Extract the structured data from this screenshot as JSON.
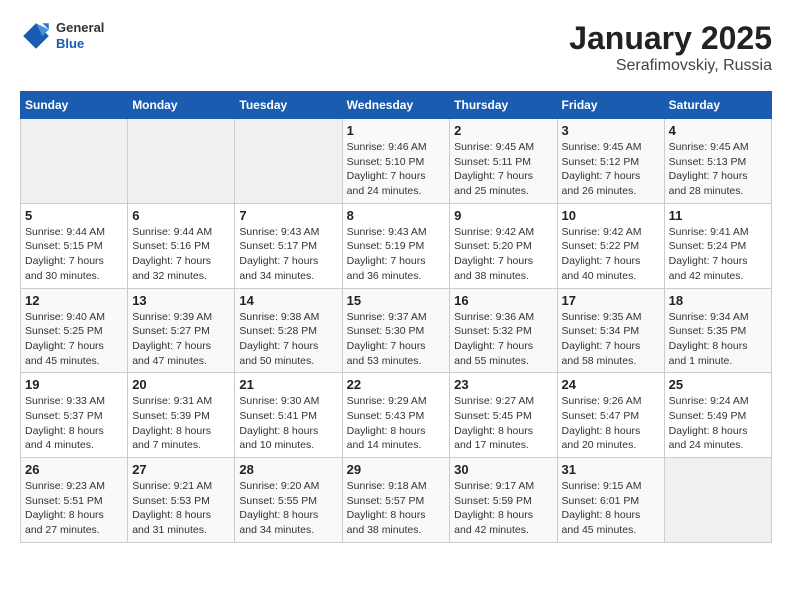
{
  "header": {
    "logo": {
      "general": "General",
      "blue": "Blue"
    },
    "title": "January 2025",
    "subtitle": "Serafimovskiy, Russia"
  },
  "weekdays": [
    "Sunday",
    "Monday",
    "Tuesday",
    "Wednesday",
    "Thursday",
    "Friday",
    "Saturday"
  ],
  "weeks": [
    [
      {
        "day": "",
        "info": ""
      },
      {
        "day": "",
        "info": ""
      },
      {
        "day": "",
        "info": ""
      },
      {
        "day": "1",
        "info": "Sunrise: 9:46 AM\nSunset: 5:10 PM\nDaylight: 7 hours\nand 24 minutes."
      },
      {
        "day": "2",
        "info": "Sunrise: 9:45 AM\nSunset: 5:11 PM\nDaylight: 7 hours\nand 25 minutes."
      },
      {
        "day": "3",
        "info": "Sunrise: 9:45 AM\nSunset: 5:12 PM\nDaylight: 7 hours\nand 26 minutes."
      },
      {
        "day": "4",
        "info": "Sunrise: 9:45 AM\nSunset: 5:13 PM\nDaylight: 7 hours\nand 28 minutes."
      }
    ],
    [
      {
        "day": "5",
        "info": "Sunrise: 9:44 AM\nSunset: 5:15 PM\nDaylight: 7 hours\nand 30 minutes."
      },
      {
        "day": "6",
        "info": "Sunrise: 9:44 AM\nSunset: 5:16 PM\nDaylight: 7 hours\nand 32 minutes."
      },
      {
        "day": "7",
        "info": "Sunrise: 9:43 AM\nSunset: 5:17 PM\nDaylight: 7 hours\nand 34 minutes."
      },
      {
        "day": "8",
        "info": "Sunrise: 9:43 AM\nSunset: 5:19 PM\nDaylight: 7 hours\nand 36 minutes."
      },
      {
        "day": "9",
        "info": "Sunrise: 9:42 AM\nSunset: 5:20 PM\nDaylight: 7 hours\nand 38 minutes."
      },
      {
        "day": "10",
        "info": "Sunrise: 9:42 AM\nSunset: 5:22 PM\nDaylight: 7 hours\nand 40 minutes."
      },
      {
        "day": "11",
        "info": "Sunrise: 9:41 AM\nSunset: 5:24 PM\nDaylight: 7 hours\nand 42 minutes."
      }
    ],
    [
      {
        "day": "12",
        "info": "Sunrise: 9:40 AM\nSunset: 5:25 PM\nDaylight: 7 hours\nand 45 minutes."
      },
      {
        "day": "13",
        "info": "Sunrise: 9:39 AM\nSunset: 5:27 PM\nDaylight: 7 hours\nand 47 minutes."
      },
      {
        "day": "14",
        "info": "Sunrise: 9:38 AM\nSunset: 5:28 PM\nDaylight: 7 hours\nand 50 minutes."
      },
      {
        "day": "15",
        "info": "Sunrise: 9:37 AM\nSunset: 5:30 PM\nDaylight: 7 hours\nand 53 minutes."
      },
      {
        "day": "16",
        "info": "Sunrise: 9:36 AM\nSunset: 5:32 PM\nDaylight: 7 hours\nand 55 minutes."
      },
      {
        "day": "17",
        "info": "Sunrise: 9:35 AM\nSunset: 5:34 PM\nDaylight: 7 hours\nand 58 minutes."
      },
      {
        "day": "18",
        "info": "Sunrise: 9:34 AM\nSunset: 5:35 PM\nDaylight: 8 hours\nand 1 minute."
      }
    ],
    [
      {
        "day": "19",
        "info": "Sunrise: 9:33 AM\nSunset: 5:37 PM\nDaylight: 8 hours\nand 4 minutes."
      },
      {
        "day": "20",
        "info": "Sunrise: 9:31 AM\nSunset: 5:39 PM\nDaylight: 8 hours\nand 7 minutes."
      },
      {
        "day": "21",
        "info": "Sunrise: 9:30 AM\nSunset: 5:41 PM\nDaylight: 8 hours\nand 10 minutes."
      },
      {
        "day": "22",
        "info": "Sunrise: 9:29 AM\nSunset: 5:43 PM\nDaylight: 8 hours\nand 14 minutes."
      },
      {
        "day": "23",
        "info": "Sunrise: 9:27 AM\nSunset: 5:45 PM\nDaylight: 8 hours\nand 17 minutes."
      },
      {
        "day": "24",
        "info": "Sunrise: 9:26 AM\nSunset: 5:47 PM\nDaylight: 8 hours\nand 20 minutes."
      },
      {
        "day": "25",
        "info": "Sunrise: 9:24 AM\nSunset: 5:49 PM\nDaylight: 8 hours\nand 24 minutes."
      }
    ],
    [
      {
        "day": "26",
        "info": "Sunrise: 9:23 AM\nSunset: 5:51 PM\nDaylight: 8 hours\nand 27 minutes."
      },
      {
        "day": "27",
        "info": "Sunrise: 9:21 AM\nSunset: 5:53 PM\nDaylight: 8 hours\nand 31 minutes."
      },
      {
        "day": "28",
        "info": "Sunrise: 9:20 AM\nSunset: 5:55 PM\nDaylight: 8 hours\nand 34 minutes."
      },
      {
        "day": "29",
        "info": "Sunrise: 9:18 AM\nSunset: 5:57 PM\nDaylight: 8 hours\nand 38 minutes."
      },
      {
        "day": "30",
        "info": "Sunrise: 9:17 AM\nSunset: 5:59 PM\nDaylight: 8 hours\nand 42 minutes."
      },
      {
        "day": "31",
        "info": "Sunrise: 9:15 AM\nSunset: 6:01 PM\nDaylight: 8 hours\nand 45 minutes."
      },
      {
        "day": "",
        "info": ""
      }
    ]
  ]
}
